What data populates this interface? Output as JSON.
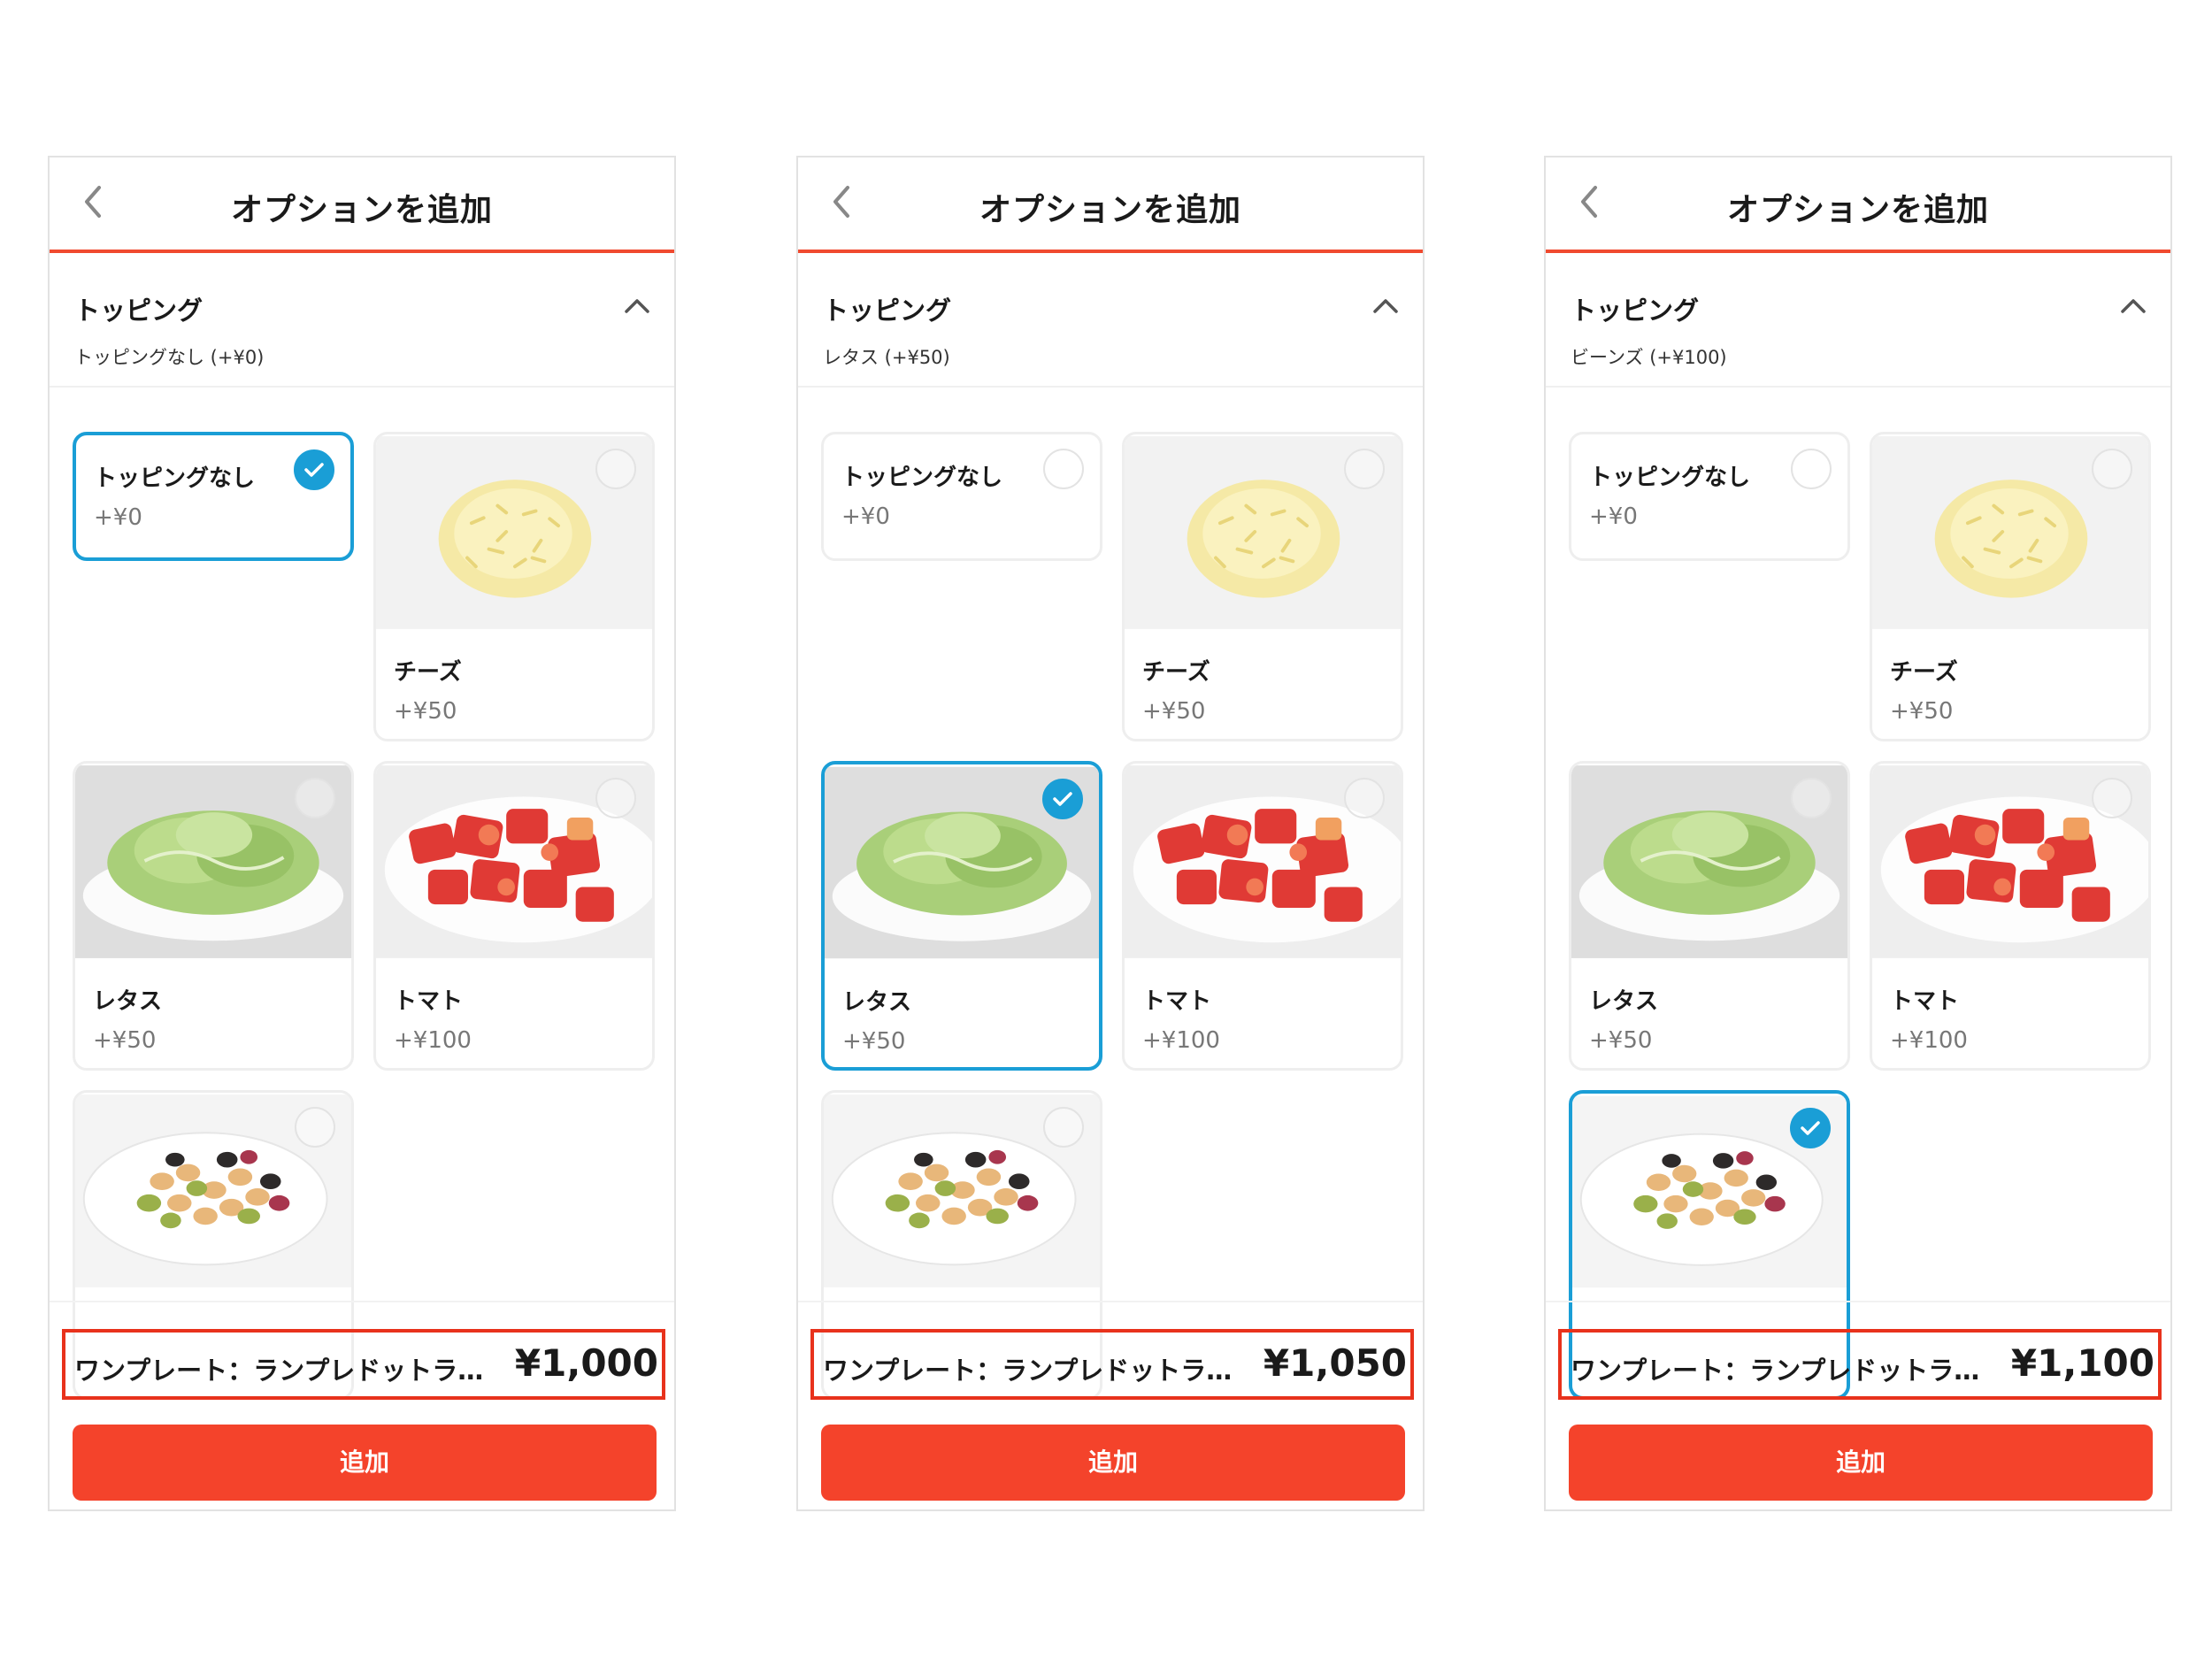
{
  "screens": [
    {
      "nav": {
        "title": "オプションを追加"
      },
      "section": {
        "title": "トッピング",
        "selected_summary": "トッピングなし (+¥0)"
      },
      "options": [
        {
          "name": "トッピングなし",
          "price": "+¥0",
          "selected": true
        },
        {
          "name": "チーズ",
          "price": "+¥50",
          "selected": false
        },
        {
          "name": "レタス",
          "price": "+¥50",
          "selected": false
        },
        {
          "name": "トマト",
          "price": "+¥100",
          "selected": false
        },
        {
          "name": "",
          "price": "",
          "selected": false
        }
      ],
      "summary": {
        "name": "ワンプレート：ランプレドットラ…",
        "price": "¥1,000"
      },
      "add_label": "追加"
    },
    {
      "nav": {
        "title": "オプションを追加"
      },
      "section": {
        "title": "トッピング",
        "selected_summary": "レタス (+¥50)"
      },
      "options": [
        {
          "name": "トッピングなし",
          "price": "+¥0",
          "selected": false
        },
        {
          "name": "チーズ",
          "price": "+¥50",
          "selected": false
        },
        {
          "name": "レタス",
          "price": "+¥50",
          "selected": true
        },
        {
          "name": "トマト",
          "price": "+¥100",
          "selected": false
        },
        {
          "name": "",
          "price": "",
          "selected": false
        }
      ],
      "summary": {
        "name": "ワンプレート：ランプレドットラ…",
        "price": "¥1,050"
      },
      "add_label": "追加"
    },
    {
      "nav": {
        "title": "オプションを追加"
      },
      "section": {
        "title": "トッピング",
        "selected_summary": "ビーンズ (+¥100)"
      },
      "options": [
        {
          "name": "トッピングなし",
          "price": "+¥0",
          "selected": false
        },
        {
          "name": "チーズ",
          "price": "+¥50",
          "selected": false
        },
        {
          "name": "レタス",
          "price": "+¥50",
          "selected": false
        },
        {
          "name": "トマト",
          "price": "+¥100",
          "selected": false
        },
        {
          "name": "",
          "price": "",
          "selected": true
        }
      ],
      "summary": {
        "name": "ワンプレート：ランプレドットラ…",
        "price": "¥1,100"
      },
      "add_label": "追加"
    }
  ],
  "colors": {
    "accent": "#f4432b",
    "selected": "#1a9ed6",
    "summary_border": "#e8321c"
  },
  "icons": {
    "back": "chevron-left-icon",
    "collapse": "chevron-up-icon",
    "check": "check-icon"
  }
}
